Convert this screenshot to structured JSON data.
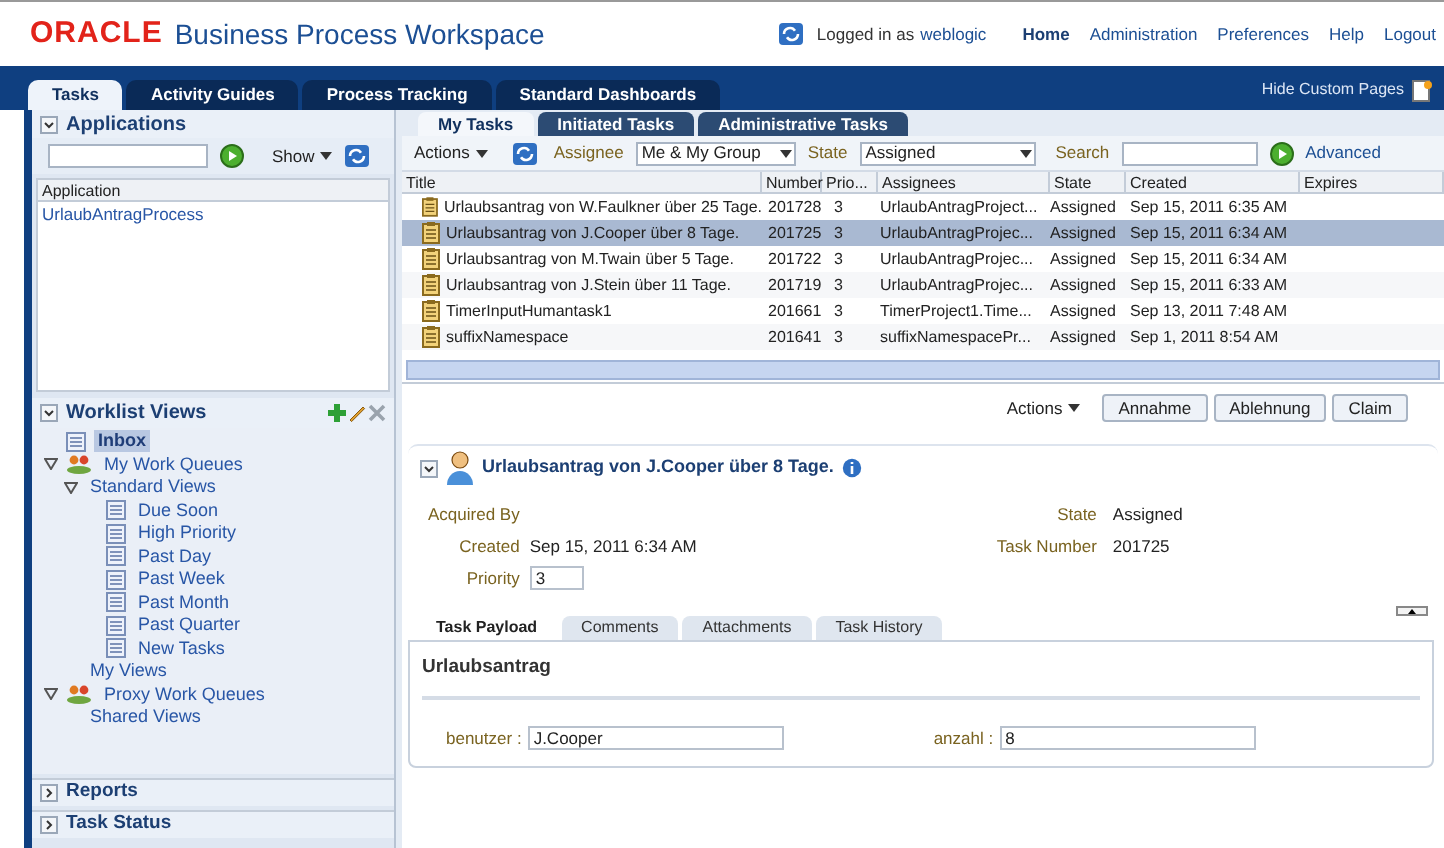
{
  "header": {
    "logo": "ORACLE",
    "product": "Business Process Workspace",
    "logged_in_prefix": "Logged in as",
    "user": "weblogic",
    "nav_links": [
      {
        "label": "Home",
        "selected": true
      },
      {
        "label": "Administration",
        "selected": false
      },
      {
        "label": "Preferences",
        "selected": false
      },
      {
        "label": "Help",
        "selected": false
      },
      {
        "label": "Logout",
        "selected": false
      }
    ]
  },
  "main_tabs": [
    {
      "label": "Tasks",
      "selected": true
    },
    {
      "label": "Activity Guides",
      "selected": false
    },
    {
      "label": "Process Tracking",
      "selected": false
    },
    {
      "label": "Standard Dashboards",
      "selected": false
    }
  ],
  "hide_custom_pages": "Hide Custom Pages",
  "applications": {
    "title": "Applications",
    "show_button": "Show",
    "column": "Application",
    "items": [
      "UrlaubAntragProcess"
    ]
  },
  "worklist_views": {
    "title": "Worklist Views",
    "tree": [
      {
        "label": "Inbox",
        "kind": "view",
        "selected": true
      },
      {
        "label": "My Work Queues",
        "kind": "queue",
        "selected": false,
        "expanded": true,
        "children": [
          {
            "label": "Standard Views",
            "selected": false,
            "expanded": true,
            "children": [
              {
                "label": "Due Soon",
                "kind": "view",
                "selected": false
              },
              {
                "label": "High Priority",
                "kind": "view",
                "selected": false
              },
              {
                "label": "Past Day",
                "kind": "view",
                "selected": false
              },
              {
                "label": "Past Week",
                "kind": "view",
                "selected": false
              },
              {
                "label": "Past Month",
                "kind": "view",
                "selected": false
              },
              {
                "label": "Past Quarter",
                "kind": "view",
                "selected": false
              },
              {
                "label": "New Tasks",
                "kind": "view",
                "selected": false
              }
            ]
          },
          {
            "label": "My Views",
            "selected": false
          }
        ]
      },
      {
        "label": "Proxy Work Queues",
        "kind": "queue",
        "selected": false,
        "expanded": true,
        "children": [
          {
            "label": "Shared Views",
            "selected": false
          }
        ]
      }
    ]
  },
  "accordions": [
    {
      "label": "Reports",
      "expanded": false
    },
    {
      "label": "Task Status",
      "expanded": false
    }
  ],
  "sub_tabs": [
    {
      "label": "My Tasks",
      "selected": true
    },
    {
      "label": "Initiated Tasks",
      "selected": false
    },
    {
      "label": "Administrative Tasks",
      "selected": false
    }
  ],
  "toolbar": {
    "actions": "Actions",
    "assignee_label": "Assignee",
    "assignee_value": "Me & My Group",
    "state_label": "State",
    "state_value": "Assigned",
    "search_label": "Search",
    "advanced": "Advanced"
  },
  "table": {
    "columns": [
      "Title",
      "Number",
      "Prio...",
      "Assignees",
      "State",
      "Created",
      "Expires"
    ],
    "rows": [
      {
        "title": "Urlaubsantrag von W.Faulkner über 25 Tage.",
        "number": "201728",
        "priority": "3",
        "assignees": "UrlaubAntragProject...",
        "state": "Assigned",
        "created": "Sep 15, 2011 6:35 AM",
        "selected": false
      },
      {
        "title": "Urlaubsantrag von J.Cooper über 8 Tage.",
        "number": "201725",
        "priority": "3",
        "assignees": "UrlaubAntragProjec...",
        "state": "Assigned",
        "created": "Sep 15, 2011 6:34 AM",
        "selected": true
      },
      {
        "title": "Urlaubsantrag von M.Twain über 5 Tage.",
        "number": "201722",
        "priority": "3",
        "assignees": "UrlaubAntragProjec...",
        "state": "Assigned",
        "created": "Sep 15, 2011 6:34 AM",
        "selected": false
      },
      {
        "title": "Urlaubsantrag von J.Stein über 11 Tage.",
        "number": "201719",
        "priority": "3",
        "assignees": "UrlaubAntragProjec...",
        "state": "Assigned",
        "created": "Sep 15, 2011 6:33 AM",
        "selected": false
      },
      {
        "title": "TimerInputHumantask1",
        "number": "201661",
        "priority": "3",
        "assignees": "TimerProject1.Time...",
        "state": "Assigned",
        "created": "Sep 13, 2011 7:48 AM",
        "selected": false
      },
      {
        "title": "suffixNamespace",
        "number": "201641",
        "priority": "3",
        "assignees": "suffixNamespacePr...",
        "state": "Assigned",
        "created": "Sep 1, 2011 8:54 AM",
        "selected": false
      }
    ]
  },
  "detail_actions": {
    "actions": "Actions",
    "buttons": [
      "Annahme",
      "Ablehnung",
      "Claim"
    ]
  },
  "task": {
    "title": "Urlaubsantrag von J.Cooper über 8 Tage.",
    "acquired_by_label": "Acquired By",
    "created_label": "Created",
    "created_value": "Sep 15, 2011 6:34 AM",
    "priority_label": "Priority",
    "priority_value": "3",
    "state_label": "State",
    "state_value": "Assigned",
    "task_number_label": "Task Number",
    "task_number_value": "201725"
  },
  "detail_tabs": [
    {
      "label": "Task Payload",
      "selected": true
    },
    {
      "label": "Comments",
      "selected": false
    },
    {
      "label": "Attachments",
      "selected": false
    },
    {
      "label": "Task History",
      "selected": false
    }
  ],
  "payload": {
    "title": "Urlaubsantrag",
    "fields": [
      {
        "label": "benutzer :",
        "value": "J.Cooper"
      },
      {
        "label": "anzahl :",
        "value": "8"
      }
    ]
  }
}
